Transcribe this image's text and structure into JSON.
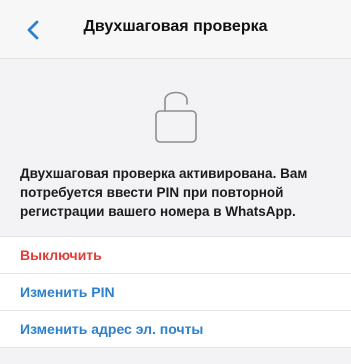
{
  "header": {
    "title": "Двухшаговая проверка",
    "back_icon": "chevron-left-icon"
  },
  "lock_icon": "lock-icon",
  "description": "Двухшаговая проверка активирована. Вам потребуется ввести PIN при повторной регистрации вашего номера в WhatsApp.",
  "actions": {
    "disable": "Выключить",
    "change_pin": "Изменить PIN",
    "change_email": "Изменить адрес эл. почты"
  },
  "colors": {
    "accent": "#2d81cc",
    "danger": "#e33b35",
    "background": "#f3f3f5"
  }
}
